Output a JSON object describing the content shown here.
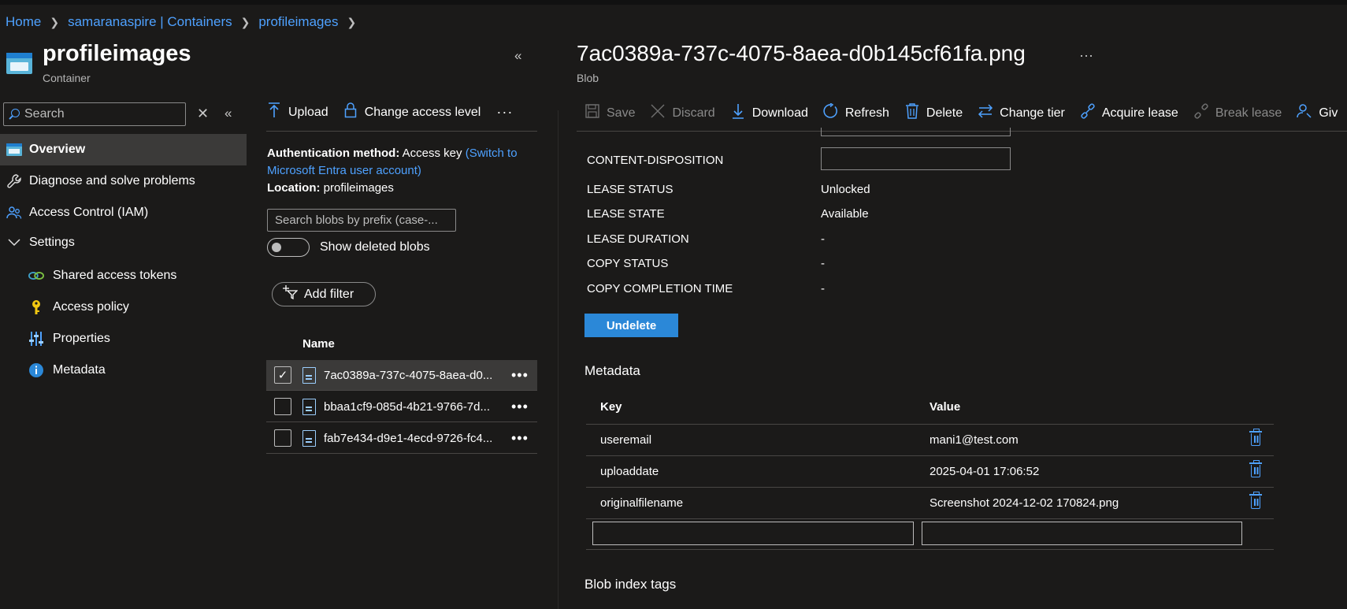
{
  "breadcrumb": [
    "Home",
    "samaranaspire | Containers",
    "profileimages"
  ],
  "resource": {
    "title": "profileimages",
    "subtitle": "Container"
  },
  "left_search": {
    "placeholder": "Search"
  },
  "nav": [
    {
      "label": "Overview",
      "icon": "container-icon",
      "active": true
    },
    {
      "label": "Diagnose and solve problems",
      "icon": "wrench-icon"
    },
    {
      "label": "Access Control (IAM)",
      "icon": "people-icon"
    },
    {
      "label": "Settings",
      "icon": "chevron-down-icon"
    },
    {
      "label": "Shared access tokens",
      "icon": "link-icon"
    },
    {
      "label": "Access policy",
      "icon": "key-icon"
    },
    {
      "label": "Properties",
      "icon": "sliders-icon"
    },
    {
      "label": "Metadata",
      "icon": "info-icon"
    }
  ],
  "mid_toolbar": {
    "upload": "Upload",
    "change_access": "Change access level"
  },
  "auth": {
    "method_label": "Authentication method:",
    "method_value": "Access key",
    "switch_link": "(Switch to Microsoft Entra user account)",
    "location_label": "Location:",
    "location_value": "profileimages"
  },
  "blob_search": {
    "placeholder": "Search blobs by prefix (case-..."
  },
  "show_deleted": {
    "label": "Show deleted blobs",
    "on": false
  },
  "add_filter": "Add filter",
  "blob_list": {
    "header": "Name",
    "rows": [
      {
        "name": "7ac0389a-737c-4075-8aea-d0...",
        "selected": true
      },
      {
        "name": "bbaa1cf9-085d-4b21-9766-7d...",
        "selected": false
      },
      {
        "name": "fab7e434-d9e1-4ecd-9726-fc4...",
        "selected": false
      }
    ]
  },
  "blob": {
    "title": "7ac0389a-737c-4075-8aea-d0b145cf61fa.png",
    "subtitle": "Blob"
  },
  "blob_toolbar": {
    "save": "Save",
    "discard": "Discard",
    "download": "Download",
    "refresh": "Refresh",
    "delete": "Delete",
    "change_tier": "Change tier",
    "acquire_lease": "Acquire lease",
    "break_lease": "Break lease",
    "give": "Giv"
  },
  "properties": [
    {
      "label": "CONTENT-DISPOSITION",
      "value": ""
    },
    {
      "label": "LEASE STATUS",
      "value": "Unlocked"
    },
    {
      "label": "LEASE STATE",
      "value": "Available"
    },
    {
      "label": "LEASE DURATION",
      "value": "-"
    },
    {
      "label": "COPY STATUS",
      "value": "-"
    },
    {
      "label": "COPY COMPLETION TIME",
      "value": "-"
    }
  ],
  "undelete": "Undelete",
  "metadata": {
    "title": "Metadata",
    "key_header": "Key",
    "value_header": "Value",
    "rows": [
      {
        "key": "useremail",
        "value": "mani1@test.com"
      },
      {
        "key": "uploaddate",
        "value": "2025-04-01 17:06:52"
      },
      {
        "key": "originalfilename",
        "value": "Screenshot 2024-12-02 170824.png"
      }
    ]
  },
  "blob_index_tags": "Blob index tags",
  "colors": {
    "accent": "#4ea1ff",
    "primary_button": "#2b88d8",
    "background": "#1b1a19",
    "selected_row": "#3b3a39"
  }
}
